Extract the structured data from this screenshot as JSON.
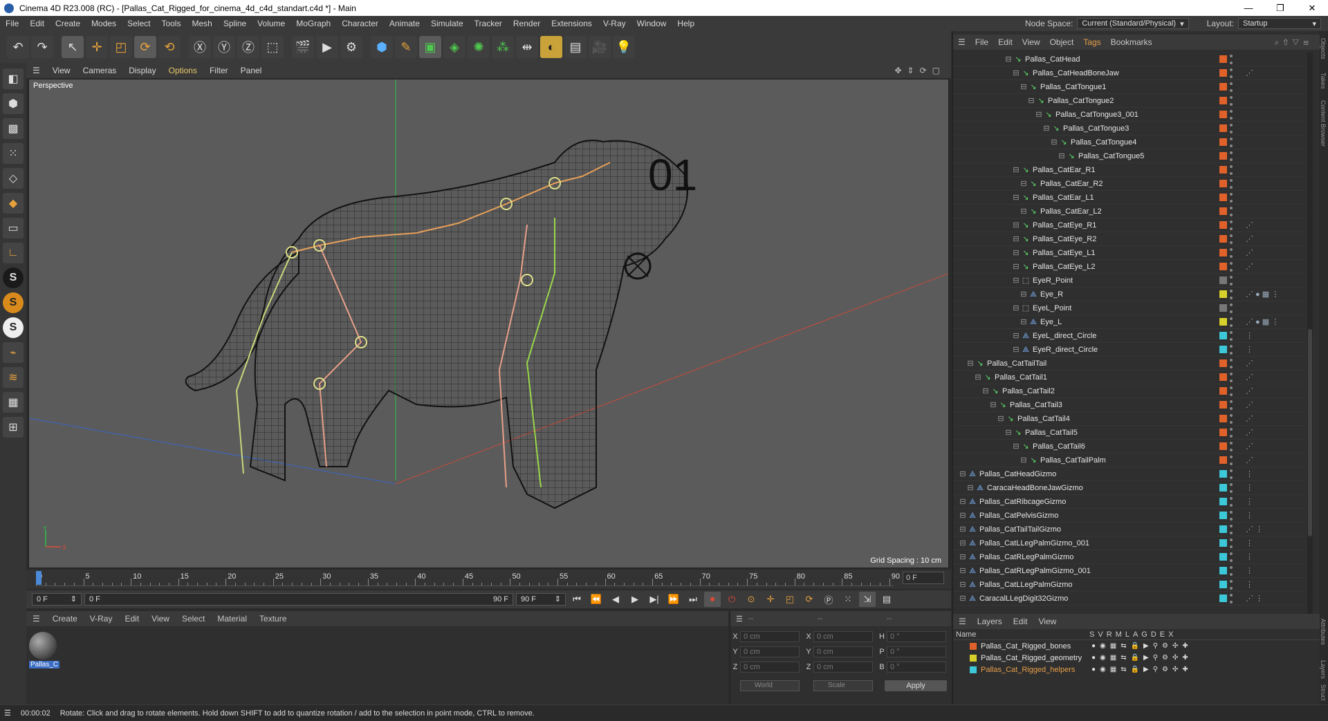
{
  "window": {
    "title": "Cinema 4D R23.008 (RC) - [Pallas_Cat_Rigged_for_cinema_4d_c4d_standart.c4d *] - Main",
    "controls": [
      "—",
      "❐",
      "✕"
    ]
  },
  "menubar": {
    "items": [
      "File",
      "Edit",
      "Create",
      "Modes",
      "Select",
      "Tools",
      "Mesh",
      "Spline",
      "Volume",
      "MoGraph",
      "Character",
      "Animate",
      "Simulate",
      "Tracker",
      "Render",
      "Extensions",
      "V-Ray",
      "Window",
      "Help"
    ],
    "node_space_label": "Node Space:",
    "node_space_value": "Current (Standard/Physical)",
    "layout_label": "Layout:",
    "layout_value": "Startup"
  },
  "viewport": {
    "menu": [
      "View",
      "Cameras",
      "Display",
      "Options",
      "Filter",
      "Panel"
    ],
    "label": "Perspective",
    "grid_spacing": "Grid Spacing : 10 cm",
    "annotation": "01",
    "axis": {
      "x": "X",
      "y": "Y"
    }
  },
  "timeline": {
    "ticks": [
      "0",
      "5",
      "10",
      "15",
      "20",
      "25",
      "30",
      "35",
      "40",
      "45",
      "50",
      "55",
      "60",
      "65",
      "70",
      "75",
      "80",
      "85",
      "90"
    ],
    "current_frame": "0 F",
    "start": "0 F",
    "range_start": "0 F",
    "range_end": "90 F",
    "end": "90 F"
  },
  "materials": {
    "menu": [
      "Create",
      "V-Ray",
      "Edit",
      "View",
      "Select",
      "Material",
      "Texture"
    ],
    "items": [
      {
        "name": "Pallas_C"
      }
    ]
  },
  "coordinates": {
    "header_left": "--",
    "header_mid": "--",
    "header_right": "--",
    "rows": [
      {
        "a": "X",
        "av": "0 cm",
        "b": "X",
        "bv": "0 cm",
        "c": "H",
        "cv": "0 °"
      },
      {
        "a": "Y",
        "av": "0 cm",
        "b": "Y",
        "bv": "0 cm",
        "c": "P",
        "cv": "0 °"
      },
      {
        "a": "Z",
        "av": "0 cm",
        "b": "Z",
        "bv": "0 cm",
        "c": "B",
        "cv": "0 °"
      }
    ],
    "mode": "World",
    "scale": "Scale",
    "apply": "Apply"
  },
  "status": {
    "time": "00:00:02",
    "message": "Rotate: Click and drag to rotate elements. Hold down SHIFT to add to quantize rotation / add to the selection in point mode, CTRL to remove."
  },
  "objects_panel": {
    "menu": [
      "File",
      "Edit",
      "View",
      "Object",
      "Tags",
      "Bookmarks"
    ],
    "rows": [
      {
        "name": "Pallas_CatHead",
        "indent": 6,
        "icon": "bone",
        "color": "#e0622a",
        "tag": ""
      },
      {
        "name": "Pallas_CatHeadBoneJaw",
        "indent": 7,
        "icon": "bone",
        "color": "#e0622a",
        "tag": "⋰"
      },
      {
        "name": "Pallas_CatTongue1",
        "indent": 8,
        "icon": "bone",
        "color": "#e0622a",
        "tag": ""
      },
      {
        "name": "Pallas_CatTongue2",
        "indent": 9,
        "icon": "bone",
        "color": "#e0622a",
        "tag": ""
      },
      {
        "name": "Pallas_CatTongue3_001",
        "indent": 10,
        "icon": "bone",
        "color": "#e0622a",
        "tag": ""
      },
      {
        "name": "Pallas_CatTongue3",
        "indent": 11,
        "icon": "bone",
        "color": "#e0622a",
        "tag": ""
      },
      {
        "name": "Pallas_CatTongue4",
        "indent": 12,
        "icon": "bone",
        "color": "#e0622a",
        "tag": ""
      },
      {
        "name": "Pallas_CatTongue5",
        "indent": 13,
        "icon": "bone",
        "color": "#e0622a",
        "tag": ""
      },
      {
        "name": "Pallas_CatEar_R1",
        "indent": 7,
        "icon": "bone",
        "color": "#e0622a",
        "tag": ""
      },
      {
        "name": "Pallas_CatEar_R2",
        "indent": 8,
        "icon": "bone",
        "color": "#e0622a",
        "tag": ""
      },
      {
        "name": "Pallas_CatEar_L1",
        "indent": 7,
        "icon": "bone",
        "color": "#e0622a",
        "tag": ""
      },
      {
        "name": "Pallas_CatEar_L2",
        "indent": 8,
        "icon": "bone",
        "color": "#e0622a",
        "tag": ""
      },
      {
        "name": "Pallas_CatEye_R1",
        "indent": 7,
        "icon": "bone",
        "color": "#e0622a",
        "tag": "⋰"
      },
      {
        "name": "Pallas_CatEye_R2",
        "indent": 7,
        "icon": "bone",
        "color": "#e0622a",
        "tag": "⋰"
      },
      {
        "name": "Pallas_CatEye_L1",
        "indent": 7,
        "icon": "bone",
        "color": "#e0622a",
        "tag": "⋰"
      },
      {
        "name": "Pallas_CatEye_L2",
        "indent": 7,
        "icon": "bone",
        "color": "#e0622a",
        "tag": "⋰"
      },
      {
        "name": "EyeR_Point",
        "indent": 7,
        "icon": "null",
        "color": "#777777",
        "tag": ""
      },
      {
        "name": "Eye_R",
        "indent": 8,
        "icon": "helper",
        "color": "#d8d02a",
        "tag": "⋰ ● ▦ ⋮"
      },
      {
        "name": "EyeL_Point",
        "indent": 7,
        "icon": "null",
        "color": "#777777",
        "tag": ""
      },
      {
        "name": "Eye_L",
        "indent": 8,
        "icon": "helper",
        "color": "#d8d02a",
        "tag": "⋰ ● ▦ ⋮"
      },
      {
        "name": "EyeL_direct_Circle",
        "indent": 7,
        "icon": "helper",
        "color": "#3cc8d8",
        "tag": "⋮"
      },
      {
        "name": "EyeR_direct_Circle",
        "indent": 7,
        "icon": "helper",
        "color": "#3cc8d8",
        "tag": "⋮"
      },
      {
        "name": "Pallas_CatTailTail",
        "indent": 1,
        "icon": "bone",
        "color": "#e0622a",
        "tag": "⋰"
      },
      {
        "name": "Pallas_CatTail1",
        "indent": 2,
        "icon": "bone",
        "color": "#e0622a",
        "tag": "⋰"
      },
      {
        "name": "Pallas_CatTail2",
        "indent": 3,
        "icon": "bone",
        "color": "#e0622a",
        "tag": "⋰"
      },
      {
        "name": "Pallas_CatTail3",
        "indent": 4,
        "icon": "bone",
        "color": "#e0622a",
        "tag": "⋰"
      },
      {
        "name": "Pallas_CatTail4",
        "indent": 5,
        "icon": "bone",
        "color": "#e0622a",
        "tag": "⋰"
      },
      {
        "name": "Pallas_CatTail5",
        "indent": 6,
        "icon": "bone",
        "color": "#e0622a",
        "tag": "⋰"
      },
      {
        "name": "Pallas_CatTail6",
        "indent": 7,
        "icon": "bone",
        "color": "#e0622a",
        "tag": "⋰"
      },
      {
        "name": "Pallas_CatTailPalm",
        "indent": 8,
        "icon": "bone",
        "color": "#e0622a",
        "tag": "⋰"
      },
      {
        "name": "Pallas_CatHeadGizmo",
        "indent": 0,
        "icon": "helper",
        "color": "#3cc8d8",
        "tag": "⋮"
      },
      {
        "name": "CaracaHeadBoneJawGizmo",
        "indent": 1,
        "icon": "helper",
        "color": "#3cc8d8",
        "tag": "⋮"
      },
      {
        "name": "Pallas_CatRibcageGizmo",
        "indent": 0,
        "icon": "helper",
        "color": "#3cc8d8",
        "tag": "⋮"
      },
      {
        "name": "Pallas_CatPelvisGizmo",
        "indent": 0,
        "icon": "helper",
        "color": "#3cc8d8",
        "tag": "⋮"
      },
      {
        "name": "Pallas_CatTailTailGizmo",
        "indent": 0,
        "icon": "helper",
        "color": "#3cc8d8",
        "tag": "⋰ ⋮"
      },
      {
        "name": "Pallas_CatLLegPalmGizmo_001",
        "indent": 0,
        "icon": "helper",
        "color": "#3cc8d8",
        "tag": "⋮"
      },
      {
        "name": "Pallas_CatRLegPalmGizmo",
        "indent": 0,
        "icon": "helper",
        "color": "#3cc8d8",
        "tag": "⋮"
      },
      {
        "name": "Pallas_CatRLegPalmGizmo_001",
        "indent": 0,
        "icon": "helper",
        "color": "#3cc8d8",
        "tag": "⋮"
      },
      {
        "name": "Pallas_CatLLegPalmGizmo",
        "indent": 0,
        "icon": "helper",
        "color": "#3cc8d8",
        "tag": "⋮"
      },
      {
        "name": "CaracalLLegDigit32Gizmo",
        "indent": 0,
        "icon": "helper",
        "color": "#3cc8d8",
        "tag": "⋰ ⋮"
      }
    ]
  },
  "layers_panel": {
    "menu": [
      "Layers",
      "Edit",
      "View"
    ],
    "columns": [
      "Name",
      "S",
      "V",
      "R",
      "M",
      "L",
      "A",
      "G",
      "D",
      "E",
      "X"
    ],
    "rows": [
      {
        "name": "Pallas_Cat_Rigged_bones",
        "color": "#e0622a",
        "selected": false
      },
      {
        "name": "Pallas_Cat_Rigged_geometry",
        "color": "#d8d02a",
        "selected": false
      },
      {
        "name": "Pallas_Cat_Rigged_helpers",
        "color": "#3cc8d8",
        "selected": true
      }
    ],
    "icons": "●◉▦⇆🔒▶⚲⚙✣✚"
  },
  "side_tabs": [
    "Objects",
    "Takes",
    "Content Browser",
    "Attributes",
    "Layers",
    "Struct"
  ]
}
